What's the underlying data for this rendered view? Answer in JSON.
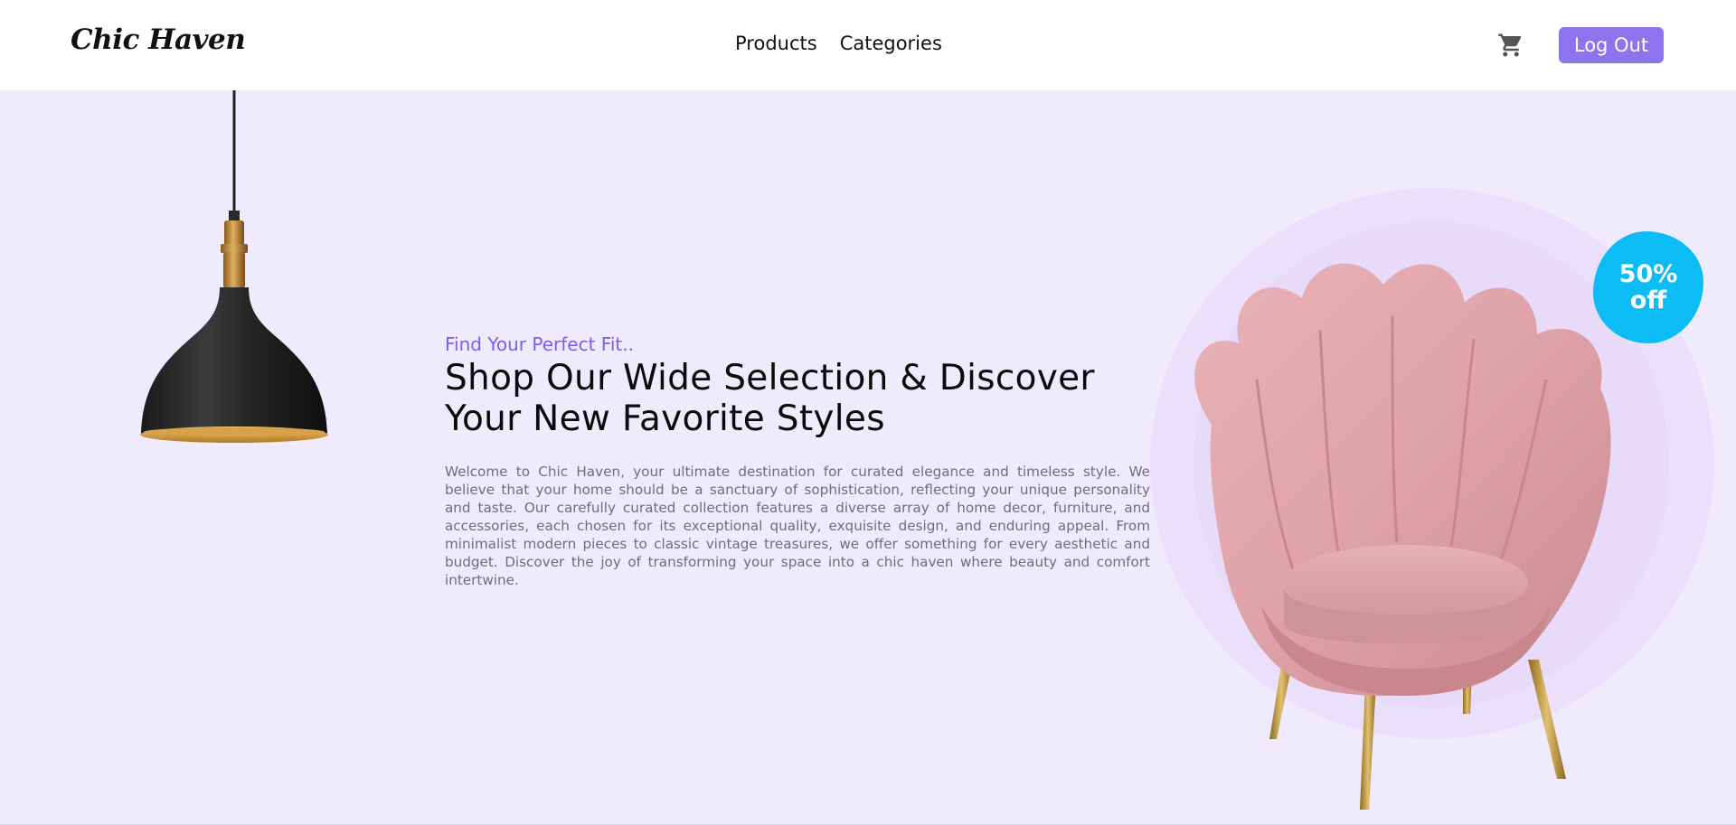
{
  "header": {
    "logo": "Chic Haven",
    "nav": [
      {
        "label": "Products"
      },
      {
        "label": "Categories"
      }
    ],
    "cart_icon": "shopping-cart-icon",
    "logout_label": "Log Out"
  },
  "hero": {
    "tagline": "Find Your Perfect Fit..",
    "headline_line1": "Shop Our Wide Selection & Discover",
    "headline_line2": "Your New Favorite Styles",
    "description": "Welcome to Chic Haven, your ultimate destination for curated elegance and timeless style. We believe that your home should be a sanctuary of sophistication, reflecting your unique personality and taste. Our carefully curated collection features a diverse array of home decor, furniture, and accessories, each chosen for its exceptional quality, exquisite design, and enduring appeal. From minimalist modern pieces to classic vintage treasures, we offer something for every aesthetic and budget. Discover the joy of transforming your space into a chic haven where beauty and comfort intertwine.",
    "badge_line1": "50%",
    "badge_line2": "off"
  },
  "colors": {
    "accent": "#8b74ee",
    "hero_background": "#efebfd",
    "badge": "#0bbcf5",
    "tagline": "#7b5cf0"
  }
}
